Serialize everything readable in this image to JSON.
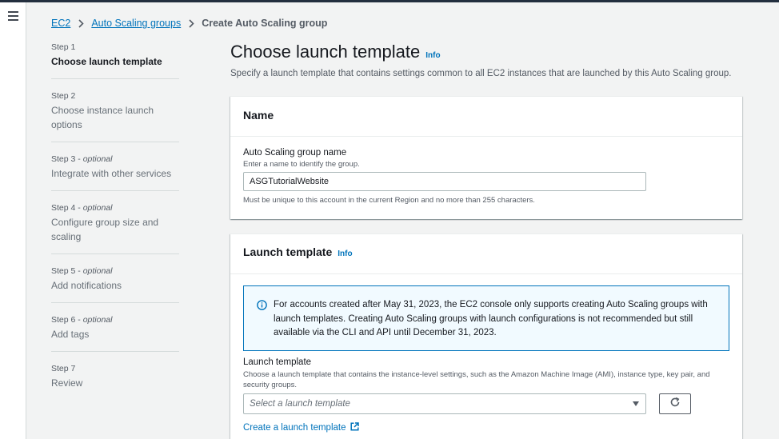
{
  "breadcrumb": {
    "items": [
      "EC2",
      "Auto Scaling groups"
    ],
    "current": "Create Auto Scaling group"
  },
  "steps": [
    {
      "number": "Step 1",
      "optional": "",
      "title": "Choose launch template"
    },
    {
      "number": "Step 2",
      "optional": "",
      "title": "Choose instance launch options"
    },
    {
      "number": "Step 3 - ",
      "optional": "optional",
      "title": "Integrate with other services"
    },
    {
      "number": "Step 4 - ",
      "optional": "optional",
      "title": "Configure group size and scaling"
    },
    {
      "number": "Step 5 - ",
      "optional": "optional",
      "title": "Add notifications"
    },
    {
      "number": "Step 6 - ",
      "optional": "optional",
      "title": "Add tags"
    },
    {
      "number": "Step 7",
      "optional": "",
      "title": "Review"
    }
  ],
  "main": {
    "title": "Choose launch template",
    "info": "Info",
    "description": "Specify a launch template that contains settings common to all EC2 instances that are launched by this Auto Scaling group."
  },
  "name_panel": {
    "title": "Name",
    "label": "Auto Scaling group name",
    "description": "Enter a name to identify the group.",
    "value": "ASGTutorialWebsite",
    "constraint": "Must be unique to this account in the current Region and no more than 255 characters."
  },
  "launch_template_panel": {
    "title": "Launch template",
    "info": "Info",
    "alert": "For accounts created after May 31, 2023, the EC2 console only supports creating Auto Scaling groups with launch templates. Creating Auto Scaling groups with launch configurations is not recommended but still available via the CLI and API until December 31, 2023.",
    "label": "Launch template",
    "description": "Choose a launch template that contains the instance-level settings, such as the Amazon Machine Image (AMI), instance type, key pair, and security groups.",
    "select_placeholder": "Select a launch template",
    "create_link": "Create a launch template"
  },
  "colors": {
    "link": "#0073bb",
    "info_border": "#0073bb",
    "info_bg": "#f1faff",
    "background": "#f2f3f3"
  }
}
